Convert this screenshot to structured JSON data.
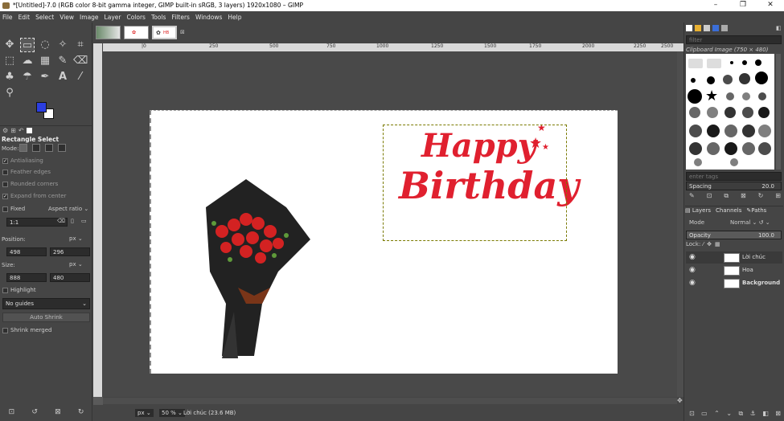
{
  "window": {
    "title": "*[Untitled]-7.0 (RGB color 8-bit gamma integer, GIMP built-in sRGB, 3 layers) 1920x1080 – GIMP",
    "minimize": "–",
    "maximize": "❐",
    "close": "✕"
  },
  "menu": [
    "File",
    "Edit",
    "Select",
    "View",
    "Image",
    "Layer",
    "Colors",
    "Tools",
    "Filters",
    "Windows",
    "Help"
  ],
  "colors": {
    "foreground": "#2b3ee0",
    "background": "#ffffff",
    "selection": "#7a7a00"
  },
  "tool_options": {
    "title": "Rectangle Select",
    "mode_label": "Mode:",
    "antialiasing": "Antialiasing",
    "feather_edges": "Feather edges",
    "rounded_corners": "Rounded corners",
    "expand_from_center": "Expand from center",
    "fixed": "Fixed",
    "fixed_mode": "Aspect ratio",
    "ratio": "1:1",
    "position_label": "Position:",
    "position_unit": "px",
    "position_x": "498",
    "position_y": "296",
    "size_label": "Size:",
    "size_unit": "px",
    "size_w": "888",
    "size_h": "480",
    "highlight": "Highlight",
    "guides": "No guides",
    "auto_shrink": "Auto Shrink",
    "shrink_merged": "Shrink merged"
  },
  "rulers": {
    "h_ticks": [
      "|0",
      "250",
      "500",
      "750",
      "1000",
      "1250",
      "1500",
      "1750",
      "2000",
      "2250",
      "2500"
    ]
  },
  "canvas": {
    "birthday_line1": "Happy",
    "birthday_line2": "Birthday"
  },
  "status": {
    "unit": "px",
    "zoom": "50 %",
    "info": "Lời chúc (23.6 MB)"
  },
  "brushes": {
    "filter_placeholder": "filter",
    "current": "Clipboard Image (750 × 480)",
    "tags_placeholder": "enter tags",
    "spacing_label": "Spacing",
    "spacing_value": "20.0"
  },
  "layers": {
    "tabs": [
      "Layers",
      "Channels",
      "Paths"
    ],
    "mode_label": "Mode",
    "mode_value": "Normal",
    "opacity_label": "Opacity",
    "opacity_value": "100.0",
    "lock_label": "Lock:",
    "items": [
      {
        "name": "Lời chúc"
      },
      {
        "name": "Hoa"
      },
      {
        "name": "Background"
      }
    ]
  }
}
